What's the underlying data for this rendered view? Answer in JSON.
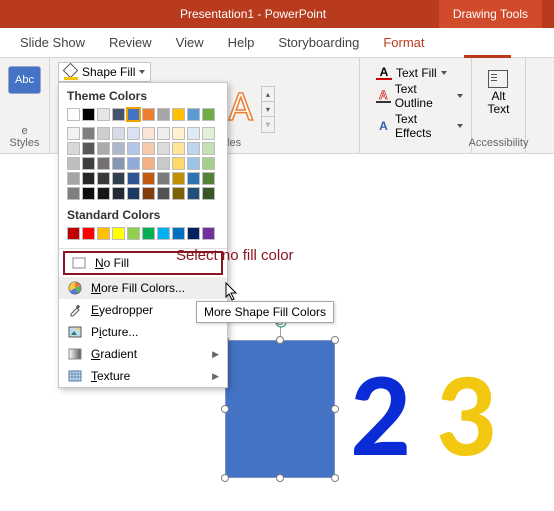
{
  "titlebar": {
    "doc": "Presentation1 - PowerPoint",
    "tool_context": "Drawing Tools"
  },
  "tabs": [
    "Slide Show",
    "Review",
    "View",
    "Help",
    "Storyboarding",
    "Format"
  ],
  "active_tab": "Format",
  "ribbon": {
    "shape_thumb_label": "Abc",
    "shape_fill_label": "Shape Fill",
    "shape_styles_group": "e Styles",
    "wordart_group": "WordArt Styles",
    "accessibility_group": "Accessibility",
    "text_fill": "Text Fill",
    "text_outline": "Text Outline",
    "text_effects": "Text Effects",
    "alt_text": "Alt\nText"
  },
  "dropdown": {
    "theme_heading": "Theme Colors",
    "standard_heading": "Standard Colors",
    "no_fill": "No Fill",
    "more_colors": "More Fill Colors...",
    "eyedropper": "Eyedropper",
    "picture": "Picture...",
    "gradient": "Gradient",
    "texture": "Texture",
    "theme_row": [
      "#ffffff",
      "#000000",
      "#e7e6e6",
      "#44546a",
      "#4472c4",
      "#ed7d31",
      "#a5a5a5",
      "#ffc000",
      "#5b9bd5",
      "#70ad47"
    ],
    "theme_tints": [
      [
        "#f2f2f2",
        "#7f7f7f",
        "#d0cece",
        "#d6dce5",
        "#d9e1f2",
        "#fbe4d5",
        "#ededed",
        "#fff2cc",
        "#deeaf6",
        "#e2efd9"
      ],
      [
        "#d8d8d8",
        "#595959",
        "#aeabab",
        "#adb9ca",
        "#b4c6e7",
        "#f7caac",
        "#dbdbdb",
        "#fee599",
        "#bdd6ee",
        "#c5e0b3"
      ],
      [
        "#bfbfbf",
        "#3f3f3f",
        "#757070",
        "#8496b0",
        "#8eaadb",
        "#f4b083",
        "#c9c9c9",
        "#ffd965",
        "#9cc2e5",
        "#a8d08d"
      ],
      [
        "#a5a5a5",
        "#262626",
        "#3a3838",
        "#323f4f",
        "#2f5496",
        "#c45911",
        "#7b7b7b",
        "#bf9000",
        "#2e74b5",
        "#538135"
      ],
      [
        "#7f7f7f",
        "#0c0c0c",
        "#171616",
        "#222a35",
        "#1f3864",
        "#833c0b",
        "#525252",
        "#7f6000",
        "#1f4e79",
        "#375623"
      ]
    ],
    "standard_row": [
      "#c00000",
      "#ff0000",
      "#ffc000",
      "#ffff00",
      "#92d050",
      "#00b050",
      "#00b0f0",
      "#0070c0",
      "#002060",
      "#7030a0"
    ],
    "selected_theme_index": 4
  },
  "tooltip": "More Shape Fill Colors",
  "annotation": "Select no fill color",
  "canvas": {
    "digit2": "2",
    "digit3": "3"
  }
}
